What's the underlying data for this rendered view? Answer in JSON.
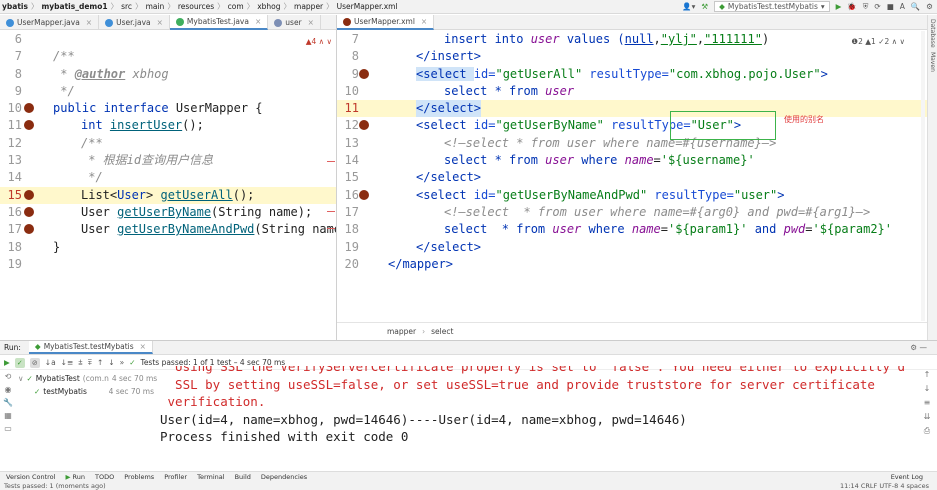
{
  "breadcrumb": [
    "ybatis",
    "mybatis_demo1",
    "src",
    "main",
    "resources",
    "com",
    "xbhog",
    "mapper",
    "UserMapper.xml"
  ],
  "run_config": "MybatisTest.testMybatis",
  "left_tabs": [
    {
      "label": "UserMapper.java",
      "color": "#3f8fd8",
      "active": false
    },
    {
      "label": "User.java",
      "color": "#3f8fd8",
      "active": false
    },
    {
      "label": "MybatisTest.java",
      "color": "#3fae5e",
      "active": true
    },
    {
      "label": "user",
      "color": "#7d8fb5",
      "active": false
    }
  ],
  "right_tabs": [
    {
      "label": "UserMapper.xml",
      "active": true
    }
  ],
  "left_inspection": "▲4 ∧ ∨",
  "right_inspection": "❶2 ▲1 ✓2 ∧ ∨",
  "left_code": {
    "line_numbers": [
      "6",
      "7",
      "8",
      "9",
      "10",
      "11",
      "12",
      "13",
      "14",
      "15",
      "16",
      "17",
      "18",
      "19"
    ],
    "l7": "/**",
    "l8_prefix": " * ",
    "l8_tag": "@author",
    "l8_rest": " xbhog",
    "l9": " */",
    "l10_kw": "public interface ",
    "l10_name": "UserMapper",
    "l10_brace": " {",
    "l11_type": "int ",
    "l11_fn": "insertUser",
    "l11_rest": "();",
    "l12": "/**",
    "l13": " * 根据id查询用户信息",
    "l14": " */",
    "l15_a": "List<",
    "l15_b": "User",
    "l15_c": "> ",
    "l15_fn": "getUserAll",
    "l15_d": "();",
    "l16_a": "User ",
    "l16_fn": "getUserByName",
    "l16_b": "(String ",
    "l16_p": "name",
    "l16_c": ");",
    "l17_a": "User ",
    "l17_fn": "getUserByNameAndPwd",
    "l17_b": "(String ",
    "l17_p": "name,",
    "l18": "}"
  },
  "right_code": {
    "line_numbers": [
      "7",
      "8",
      "9",
      "10",
      "11",
      "12",
      "13",
      "14",
      "15",
      "16",
      "17",
      "18",
      "19",
      "20"
    ],
    "l7_a": "insert into ",
    "l7_b": "user",
    "l7_c": " values (",
    "l7_d": "null",
    "l7_e": ",",
    "l7_f": "\"ylj\"",
    "l7_g": ",",
    "l7_h": "\"111111\"",
    "l7_i": ")",
    "l8": "</insert>",
    "l9_a": "<select ",
    "l9_b": "id=",
    "l9_c": "\"getUserAll\"",
    "l9_d": " resultType=",
    "l9_e": "\"com.xbhog.pojo.User\"",
    "l9_f": ">",
    "l10_a": "select * from ",
    "l10_b": "user",
    "l11": "</select>",
    "l12_a": "<select ",
    "l12_b": "id=",
    "l12_c": "\"getUserByName\"",
    "l12_d": " resultType=",
    "l12_e": "\"User\"",
    "l12_f": ">",
    "l13": "<!—select * from user where name=#{username}—>",
    "l14_a": "select * from ",
    "l14_b": "user",
    "l14_c": " where ",
    "l14_d": "name",
    "l14_e": "=",
    "l14_f": "'${username}'",
    "l15": "</select>",
    "l16_a": "<select ",
    "l16_b": "id=",
    "l16_c": "\"getUserByNameAndPwd\"",
    "l16_d": " resultType=",
    "l16_e": "\"user\"",
    "l16_f": ">",
    "l17": "<!—select  * from user where name=#{arg0} and pwd=#{arg1}—>",
    "l18_a": "select  * from ",
    "l18_b": "user",
    "l18_c": " where ",
    "l18_d": "name",
    "l18_e": "=",
    "l18_f": "'${param1}'",
    "l18_g": " and ",
    "l18_h": "pwd",
    "l18_i": "=",
    "l18_j": "'${param2}'",
    "l19": "</select>",
    "l20": "</mapper>"
  },
  "annotation_label": "使用的别名",
  "editor_breadcrumb": [
    "mapper",
    "select"
  ],
  "side_labels": [
    "Database",
    "Maven"
  ],
  "run_panel": {
    "label": "Run:",
    "tab": "MybatisTest.testMybatis",
    "status": "Tests passed: 1 of 1 test – 4 sec 70 ms",
    "tree": [
      {
        "name": "MybatisTest",
        "detail": "(com.n",
        "time": "4 sec 70 ms"
      },
      {
        "name": "testMybatis",
        "detail": "",
        "time": "4 sec 70 ms"
      }
    ],
    "console": [
      "  Using SSL the VerifyServerCertificate property is set to 'false'. You need either to explicitly disable",
      "  SSL by setting useSSL=false, or set useSSL=true and provide truststore for server certificate",
      " verification.",
      "User(id=4, name=xbhog, pwd=14646)----User(id=4, name=xbhog, pwd=14646)",
      "",
      "Process finished with exit code 0"
    ]
  },
  "bottom_tools": [
    "Version Control",
    "Run",
    "TODO",
    "Problems",
    "Profiler",
    "Terminal",
    "Build",
    "Dependencies",
    "Event Log"
  ],
  "status_left": "Tests passed: 1 (moments ago)",
  "status_right": "11:14   CRLF   UTF-8   4 spaces"
}
